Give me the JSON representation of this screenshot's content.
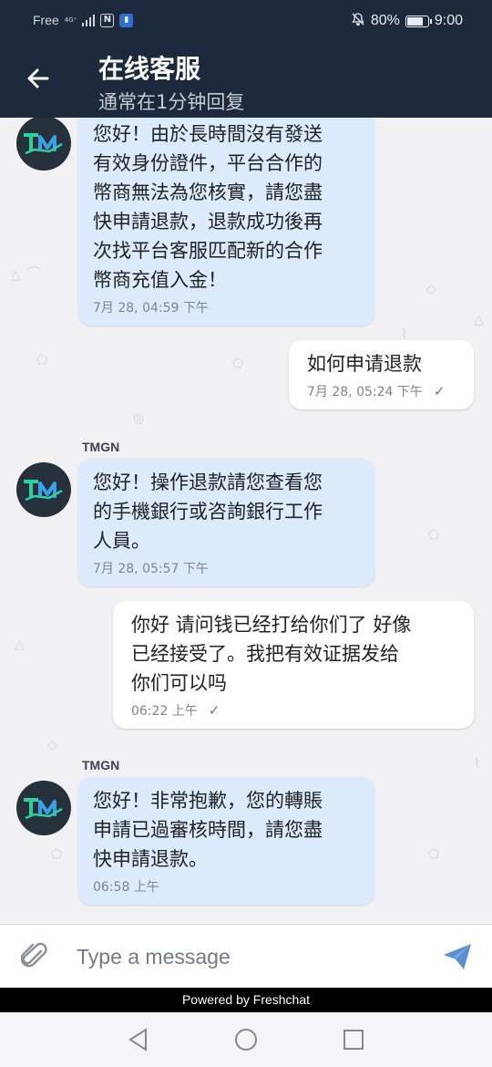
{
  "status_bar": {
    "carrier": "Free",
    "network": "4G⁺",
    "battery": "80%",
    "battery_level": 0.8,
    "time": "9:00"
  },
  "header": {
    "title": "在线客服",
    "subtitle": "通常在1分钟回复",
    "back_icon": "arrow-left-icon"
  },
  "messages": [
    {
      "direction": "incoming",
      "text": "您好！由於長時間沒有發送\n有效身份證件，平台合作的\n幣商無法為您核實，請您盡\n快申請退款，退款成功後再\n次找平台客服匹配新的合作\n幣商充值入金！",
      "time": "7月 28, 04:59 下午"
    },
    {
      "direction": "outgoing",
      "text": "如何申请退款",
      "time": "7月 28, 05:24 下午"
    },
    {
      "direction": "incoming",
      "sender": "TMGN",
      "text": "您好！操作退款請您查看您\n的手機銀行或咨詢銀行工作\n人員。",
      "time": "7月 28, 05:57 下午"
    },
    {
      "direction": "outgoing",
      "text": "你好 请问钱已经打给你们了 好像\n已经接受了。我把有效证据发给\n你们可以吗",
      "time": "06:22 上午"
    },
    {
      "direction": "incoming",
      "sender": "TMGN",
      "text": "您好！非常抱歉，您的轉賬\n申請已過審核時間，請您盡\n快申請退款。",
      "time": "06:58 上午"
    }
  ],
  "composer": {
    "placeholder": "Type a message",
    "attach_icon": "paperclip-icon",
    "send_icon": "send-icon"
  },
  "footer": {
    "powered_by": "Powered by Freshchat"
  },
  "colors": {
    "header_bg": "#1d2a3d",
    "incoming_bubble": "#dbeafc",
    "outgoing_bubble": "#ffffff",
    "send_icon": "#5b8fd4"
  }
}
